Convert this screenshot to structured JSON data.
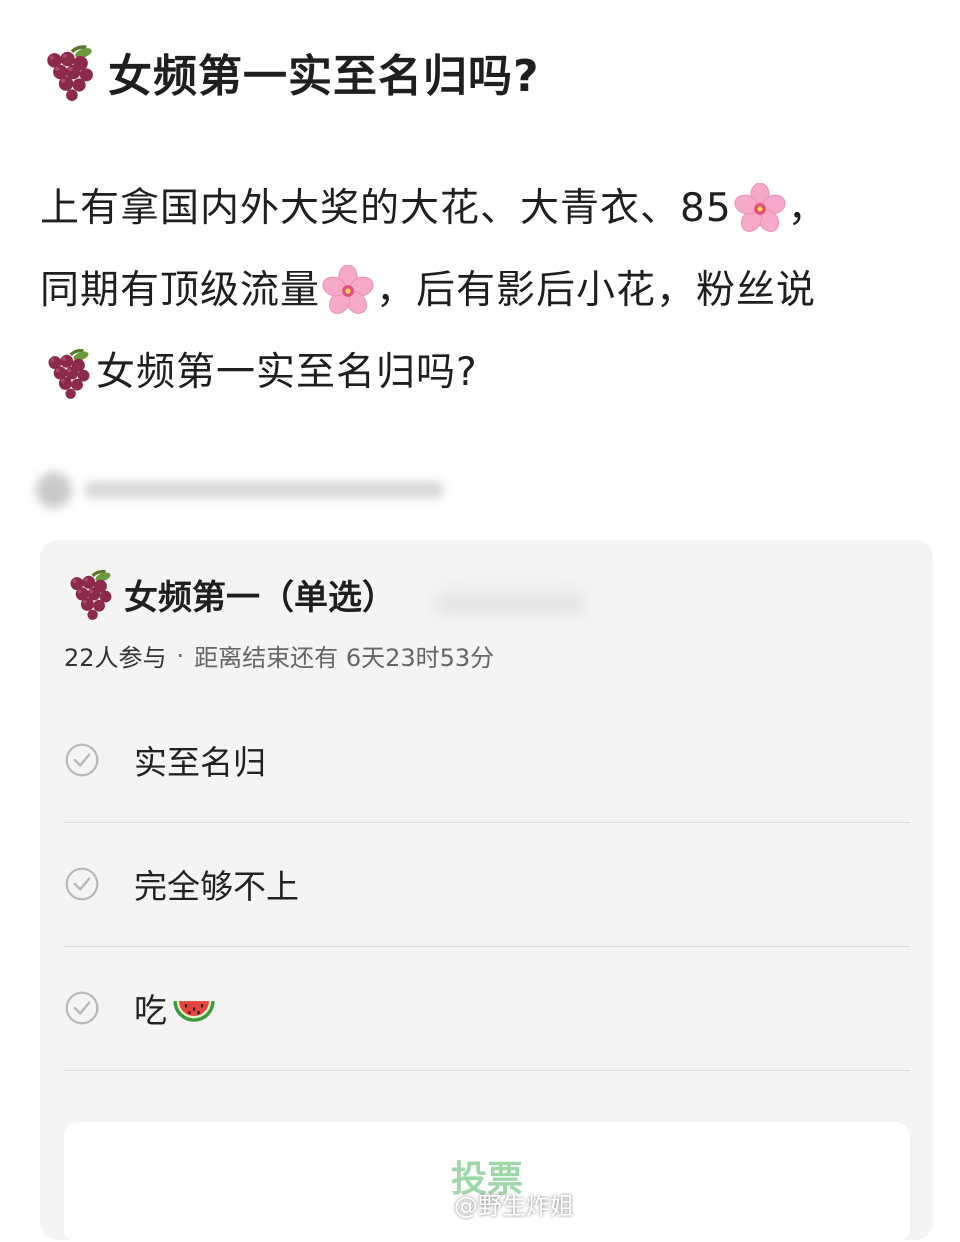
{
  "post": {
    "title": "女频第一实至名归吗?",
    "body_lines": [
      [
        "上有拿国内外大奖的大花、大青衣、85",
        "，"
      ],
      [
        "同期有顶级流量",
        "，后有影后小花，粉丝说"
      ],
      [
        "女频第一实至名归吗?"
      ]
    ],
    "title_icon": "grapes-icon",
    "flower_icon": "cherry-blossom-icon"
  },
  "poll": {
    "title": "女频第一（单选）",
    "participants": "22人参与",
    "separator": "·",
    "time_left": "距离结束还有 6天23时53分",
    "options": [
      {
        "label": "实至名归"
      },
      {
        "label": "完全够不上"
      },
      {
        "label": "吃"
      }
    ],
    "vote_label": "投票"
  },
  "watermark": {
    "text": "@野生炸姐"
  },
  "colors": {
    "vote_text": "#9fd8a8",
    "card_bg": "#f4f4f4",
    "grape": "#8b2a4a",
    "blossom": "#f6a9c8"
  }
}
